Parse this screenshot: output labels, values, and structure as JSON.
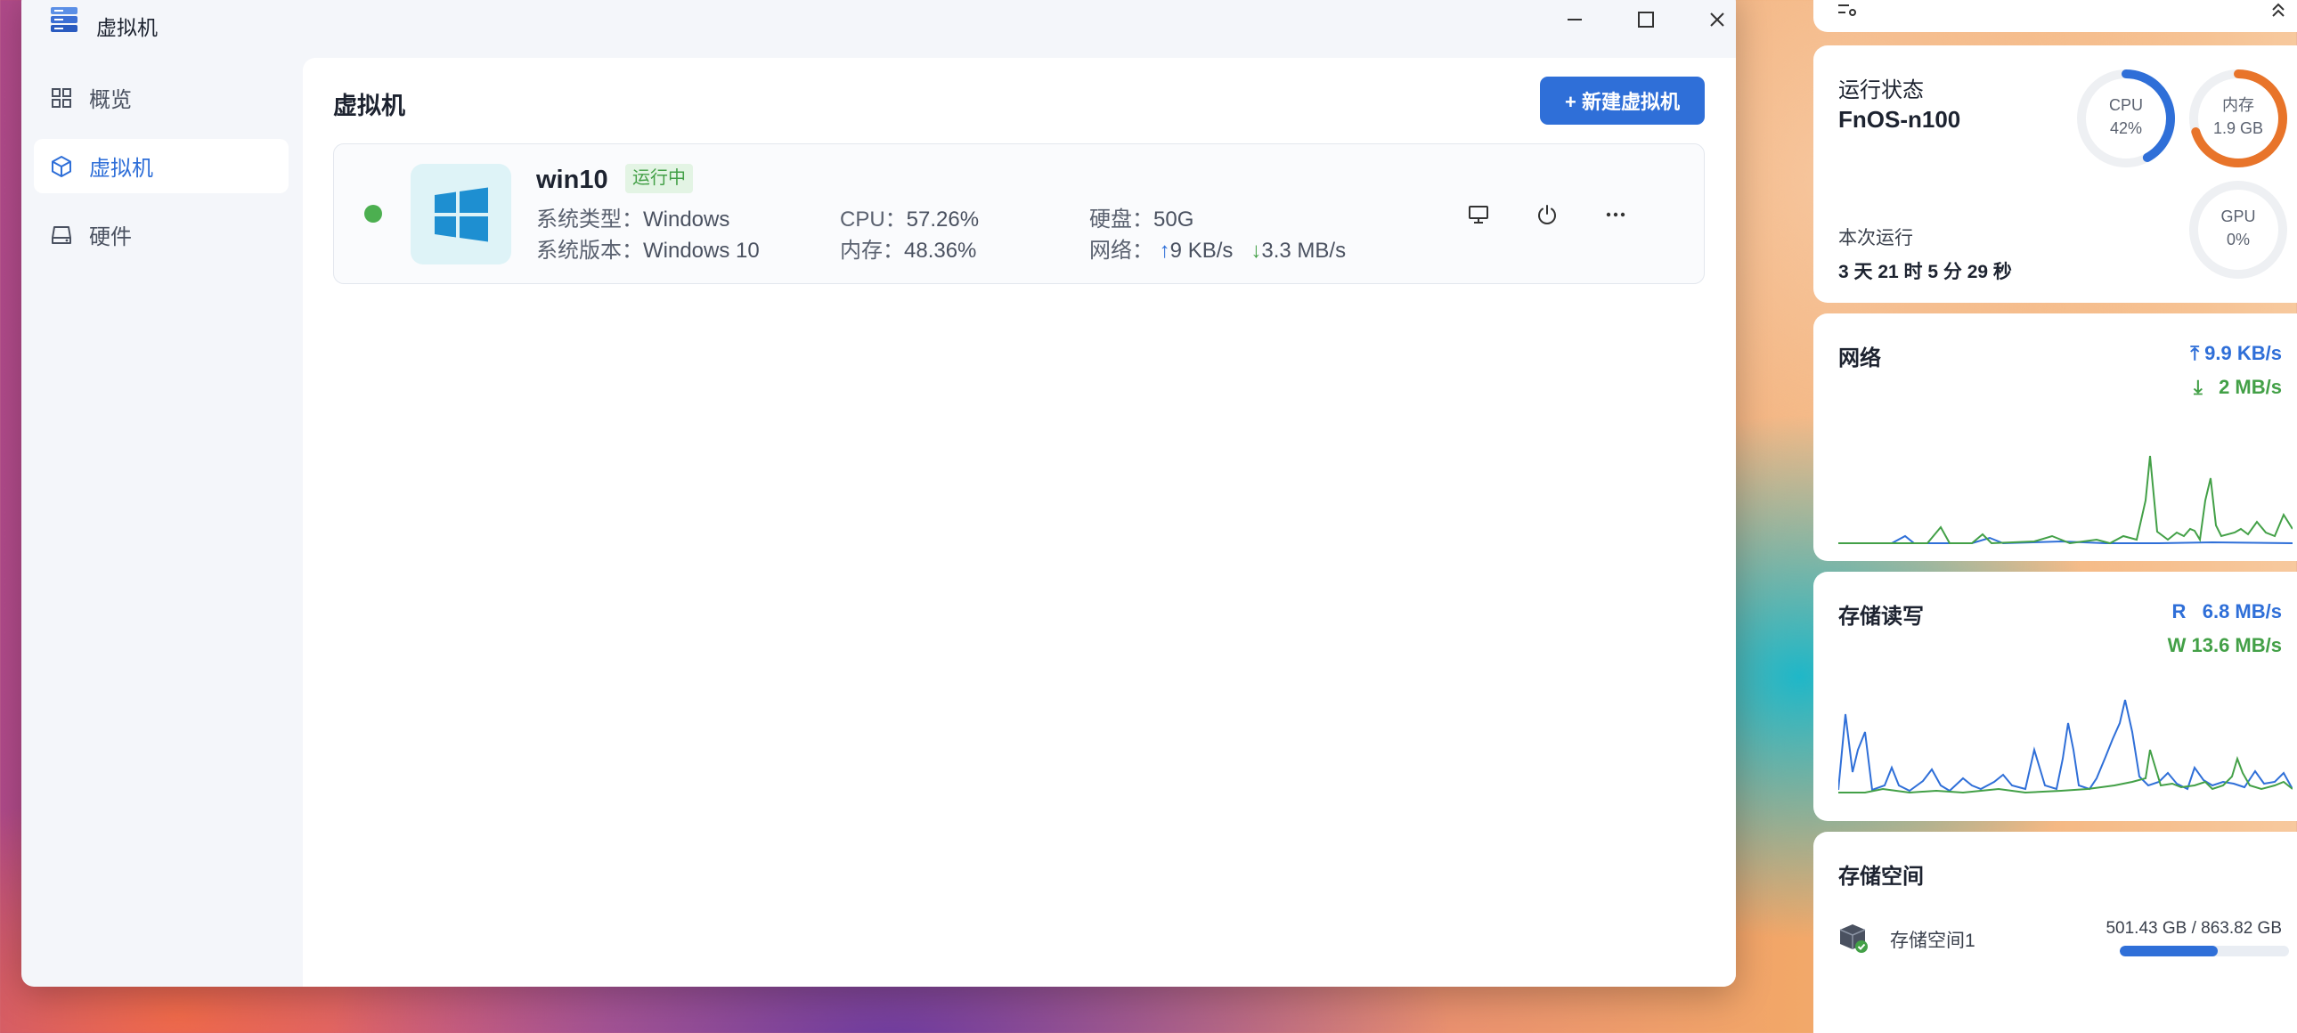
{
  "window": {
    "title": "虚拟机",
    "controls": [
      "minimize",
      "maximize",
      "close"
    ]
  },
  "sidebar": {
    "items": [
      {
        "label": "概览",
        "icon": "grid-icon",
        "active": false
      },
      {
        "label": "虚拟机",
        "icon": "cube-icon",
        "active": true
      },
      {
        "label": "硬件",
        "icon": "drive-icon",
        "active": false
      }
    ]
  },
  "main": {
    "page_title": "虚拟机",
    "new_button": "+ 新建虚拟机",
    "vm": {
      "name": "win10",
      "status": "运行中",
      "status_color": "#4caf50",
      "type_label": "系统类型：",
      "type_value": "Windows",
      "version_label": "系统版本：",
      "version_value": "Windows 10",
      "cpu_label": "CPU：",
      "cpu_value": "57.26%",
      "mem_label": "内存：",
      "mem_value": "48.36%",
      "disk_label": "硬盘：",
      "disk_value": "50G",
      "net_label": "网络：",
      "net_up": "9 KB/s",
      "net_down": "3.3 MB/s"
    }
  },
  "widgets": {
    "status": {
      "title": "运行状态",
      "hostname": "FnOS-n100",
      "cpu_label": "CPU",
      "cpu_value": "42%",
      "cpu_fraction": 0.42,
      "mem_label": "内存",
      "mem_value": "1.9 GB",
      "mem_fraction": 0.7,
      "gpu_label": "GPU",
      "gpu_value": "0%",
      "gpu_fraction": 0,
      "uptime_label": "本次运行",
      "uptime_value": "3 天 21 时 5 分 29 秒"
    },
    "network": {
      "title": "网络",
      "up": "9.9 KB/s",
      "down": "2 MB/s"
    },
    "storage_io": {
      "title": "存储读写",
      "read_label": "R",
      "read": "6.8 MB/s",
      "write_label": "W",
      "write": "13.6 MB/s"
    },
    "storage_space": {
      "title": "存储空间",
      "name": "存储空间1",
      "used": "501.43 GB",
      "separator": "/",
      "total": "863.82 GB",
      "used_fraction": 0.58
    }
  },
  "colors": {
    "accent": "#2f6fd8",
    "green": "#43a047",
    "orange": "#e8742a"
  }
}
